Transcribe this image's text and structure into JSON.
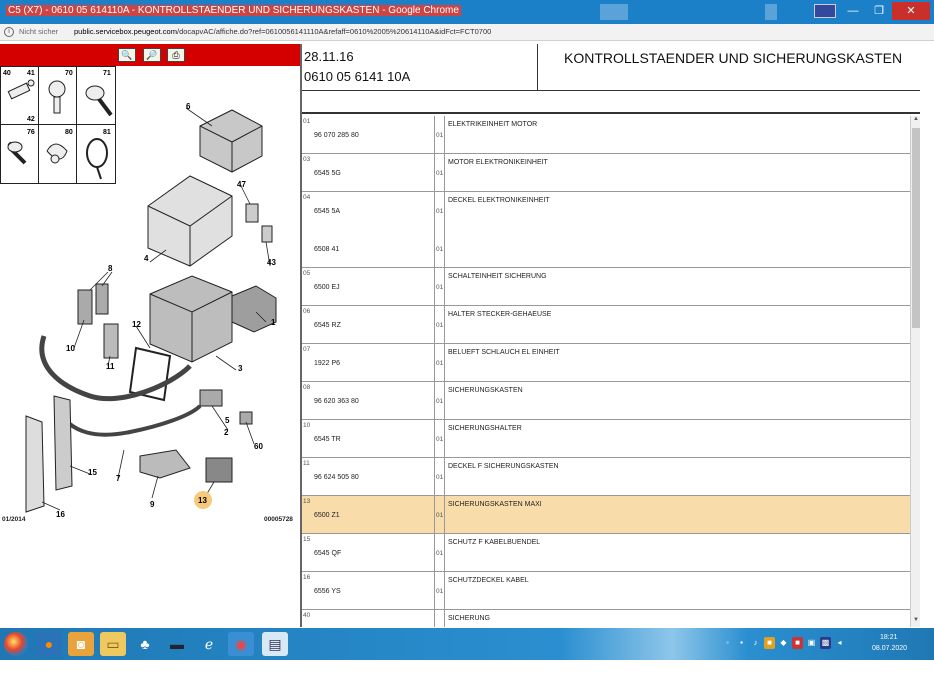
{
  "window": {
    "title": "C5 (X7) - 0610 05 614110A - KONTROLLSTAENDER UND SICHERUNGSKASTEN - Google Chrome"
  },
  "addressbar": {
    "security": "Nicht sicher",
    "domain": "public.servicebox.peugeot.com",
    "path": "/docapvAC/affiche.do?ref=0610056141110A&refaff=0610%2005%20614110A&idFct=FCT0700"
  },
  "diagram": {
    "small_parts": [
      "40",
      "41",
      "42",
      "70",
      "71",
      "76",
      "80",
      "81"
    ],
    "callouts": [
      "6",
      "47",
      "43",
      "4",
      "8",
      "12",
      "1",
      "10",
      "11",
      "3",
      "2",
      "5",
      "60",
      "15",
      "7",
      "9",
      "13",
      "16"
    ],
    "footer_left": "01/2014",
    "footer_right": "00005728"
  },
  "header": {
    "date": "28.11.16",
    "ref": "0610 05 6141 10A",
    "title": "KONTROLLSTAENDER UND SICHERUNGSKASTEN"
  },
  "rows": [
    {
      "pos": "01",
      "refs": [
        "96 070 285 80"
      ],
      "qtys": [
        "01"
      ],
      "desc": "ELEKTRIKEINHEIT MOTOR"
    },
    {
      "pos": "03",
      "refs": [
        "6545 5G"
      ],
      "qtys": [
        "01"
      ],
      "desc": "MOTOR ELEKTRONIKEINHEIT"
    },
    {
      "pos": "04",
      "refs": [
        "6545 5A",
        "6508 41"
      ],
      "qtys": [
        "01",
        "01"
      ],
      "desc": "DECKEL ELEKTRONIKEINHEIT"
    },
    {
      "pos": "05",
      "refs": [
        "6500 EJ"
      ],
      "qtys": [
        "01"
      ],
      "desc": "SCHALTEINHEIT SICHERUNG"
    },
    {
      "pos": "06",
      "refs": [
        "6545 RZ"
      ],
      "qtys": [
        "01"
      ],
      "desc": "HALTER STECKER-GEHAEUSE"
    },
    {
      "pos": "07",
      "refs": [
        "1922 P6"
      ],
      "qtys": [
        "01"
      ],
      "desc": "BELUEFT SCHLAUCH EL EINHEIT"
    },
    {
      "pos": "08",
      "refs": [
        "96 620 363 80"
      ],
      "qtys": [
        "01"
      ],
      "desc": "SICHERUNGSKASTEN"
    },
    {
      "pos": "10",
      "refs": [
        "6545 TR"
      ],
      "qtys": [
        "01"
      ],
      "desc": "SICHERUNGSHALTER"
    },
    {
      "pos": "11",
      "refs": [
        "96 624 505 80"
      ],
      "qtys": [
        "01"
      ],
      "desc": "DECKEL F SICHERUNGSKASTEN"
    },
    {
      "pos": "13",
      "refs": [
        "6500 Z1"
      ],
      "qtys": [
        "01"
      ],
      "desc": "SICHERUNGSKASTEN MAXI"
    },
    {
      "pos": "15",
      "refs": [
        "6545 QF"
      ],
      "qtys": [
        "01"
      ],
      "desc": "SCHUTZ F KABELBUENDEL"
    },
    {
      "pos": "16",
      "refs": [
        "6556 YS"
      ],
      "qtys": [
        "01"
      ],
      "desc": "SCHUTZDECKEL KABEL"
    },
    {
      "pos": "40",
      "refs": [],
      "qtys": [],
      "desc": "SICHERUNG"
    }
  ],
  "taskbar": {
    "time": "18:21",
    "date": "08.07.2020"
  }
}
